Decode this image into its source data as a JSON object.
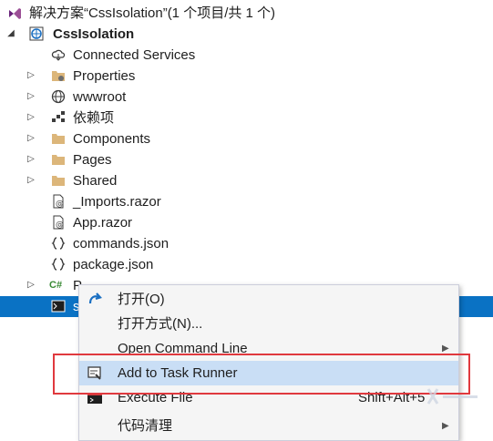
{
  "solution": {
    "title": "解决方案“CssIsolation”(1 个项目/共 1 个)"
  },
  "project": {
    "name": "CssIsolation"
  },
  "tree_items": [
    {
      "label": "Connected Services",
      "icon": "connected-services-icon",
      "expandable": false
    },
    {
      "label": "Properties",
      "icon": "properties-folder-icon",
      "expandable": true
    },
    {
      "label": "wwwroot",
      "icon": "globe-icon",
      "expandable": true
    },
    {
      "label": "依赖项",
      "icon": "dependencies-icon",
      "expandable": true
    },
    {
      "label": "Components",
      "icon": "folder-icon",
      "expandable": true
    },
    {
      "label": "Pages",
      "icon": "folder-icon",
      "expandable": true
    },
    {
      "label": "Shared",
      "icon": "folder-icon",
      "expandable": true
    },
    {
      "label": "_Imports.razor",
      "icon": "razor-file-icon",
      "expandable": false
    },
    {
      "label": "App.razor",
      "icon": "razor-file-icon",
      "expandable": false
    },
    {
      "label": "commands.json",
      "icon": "json-file-icon",
      "expandable": false
    },
    {
      "label": "package.json",
      "icon": "json-file-icon",
      "expandable": false
    },
    {
      "label": "P",
      "icon": "csharp-file-icon",
      "expandable": true
    },
    {
      "label": "s",
      "icon": "script-file-icon",
      "expandable": false,
      "selected": true
    }
  ],
  "context_menu": {
    "items": [
      {
        "label": "打开(O)",
        "icon": "open-arrow-icon",
        "shortcut": "",
        "submenu": false
      },
      {
        "label": "打开方式(N)...",
        "icon": "",
        "shortcut": "",
        "submenu": false
      },
      {
        "label": "Open Command Line",
        "icon": "",
        "shortcut": "",
        "submenu": true
      },
      {
        "label": "Add to Task Runner",
        "icon": "task-runner-icon",
        "shortcut": "",
        "submenu": false,
        "highlighted": true
      },
      {
        "label": "Execute File",
        "icon": "terminal-icon",
        "shortcut": "Shift+Alt+5",
        "submenu": false
      },
      {
        "label": "代码清理",
        "icon": "",
        "shortcut": "",
        "submenu": true
      }
    ]
  },
  "colors": {
    "selection": "#0a72c4",
    "highlight": "#c9def5",
    "annotation": "#e0393e",
    "folder": "#dcb67a"
  }
}
